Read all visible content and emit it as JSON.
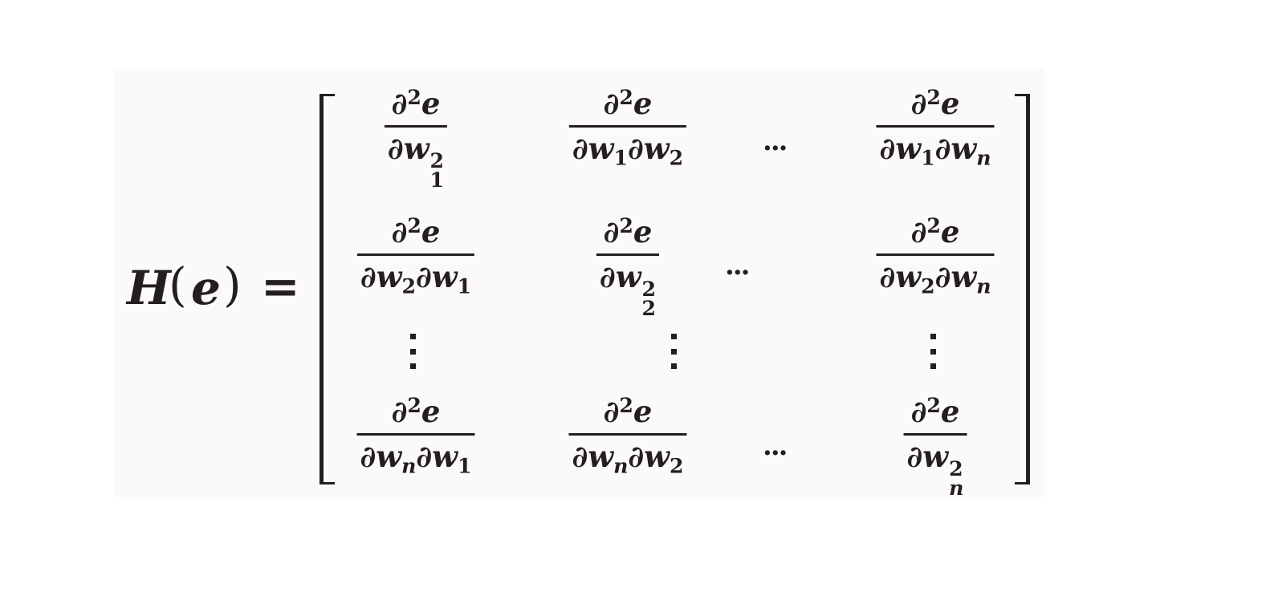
{
  "equation": {
    "lhs": {
      "symbol": "H",
      "open_paren": "(",
      "argument": "e",
      "close_paren": ")",
      "equals": "="
    },
    "matrix": {
      "numerator": {
        "partial": "∂",
        "power": "2",
        "var": "e"
      },
      "cells": {
        "r1c1": {
          "den_main": "∂w",
          "den_sup": "2",
          "den_sub": "1"
        },
        "r1c2": {
          "d1": "∂w",
          "s1": "1",
          "d2": "∂w",
          "s2": "2"
        },
        "r1c4": {
          "d1": "∂w",
          "s1": "1",
          "d2": "∂w",
          "s2": "n"
        },
        "r2c1": {
          "d1": "∂w",
          "s1": "2",
          "d2": "∂w",
          "s2": "1"
        },
        "r2c2": {
          "den_main": "∂w",
          "den_sup": "2",
          "den_sub": "2"
        },
        "r2c4": {
          "d1": "∂w",
          "s1": "2",
          "d2": "∂w",
          "s2": "n"
        },
        "r4c1": {
          "d1": "∂w",
          "s1": "n",
          "d2": "∂w",
          "s2": "1"
        },
        "r4c2": {
          "d1": "∂w",
          "s1": "n",
          "d2": "∂w",
          "s2": "2"
        },
        "r4c4": {
          "den_main": "∂w",
          "den_sup": "2",
          "den_sub": "n"
        }
      },
      "hdots": "···"
    }
  }
}
